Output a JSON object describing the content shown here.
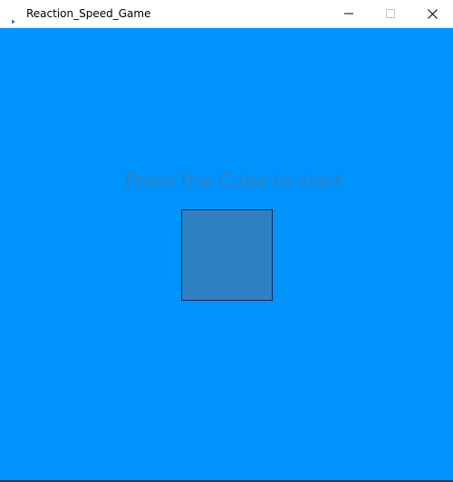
{
  "window": {
    "title": "Reaction_Speed_Game",
    "icon": "app-arrow-icon",
    "controls": {
      "minimize": "minimize-icon",
      "maximize": "maximize-icon",
      "close": "close-icon"
    }
  },
  "game": {
    "prompt": "Press the Cube to start",
    "colors": {
      "background": "#0093fd",
      "cube": "#2f80c1",
      "cube_border": "#0a2a55",
      "prompt_text": "#2f80c1"
    }
  }
}
